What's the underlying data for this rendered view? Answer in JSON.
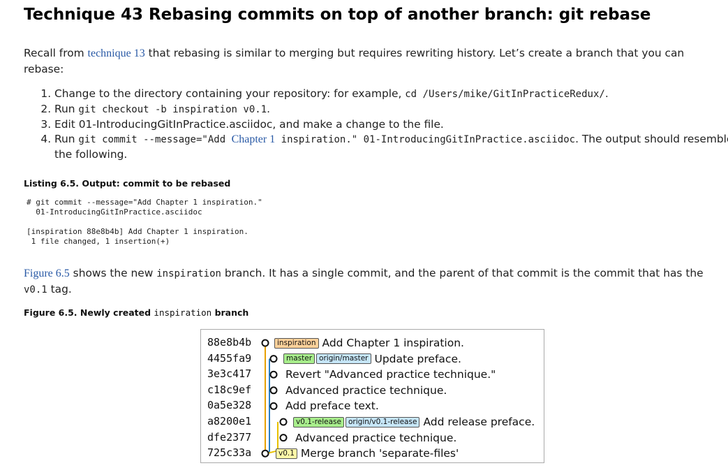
{
  "heading": "Technique 43 Rebasing commits on top of another branch: git rebase",
  "intro": {
    "t1": "Recall from ",
    "link": "technique 13",
    "t2": " that rebasing is similar to merging but requires rewriting history. Let’s create a branch that you can rebase:"
  },
  "steps": {
    "s1_text": "Change to the directory containing your repository: for example, ",
    "s1_code": "cd /Users/mike/GitInPracticeRedux/",
    "s1_end": ".",
    "s2_a": "Run ",
    "s2_code": "git checkout -b inspiration v0.1",
    "s2_end": ".",
    "s3_text": "Edit 01-IntroducingGitInPractice.asciidoc, and make a change to the file.",
    "s4_a": "Run ",
    "s4_code1": "git commit --message=\"Add ",
    "s4_link": "Chapter 1",
    "s4_code2": " inspiration.\" 01-IntroducingGitInPractice.asciidoc",
    "s4_end": ". The output should resemble the following."
  },
  "listing": {
    "caption": "Listing 6.5. Output: commit to be rebased",
    "lines": "# git commit --message=\"Add Chapter 1 inspiration.\"\n  01-IntroducingGitInPractice.asciidoc\n\n[inspiration 88e8b4b] Add Chapter 1 inspiration.\n 1 file changed, 1 insertion(+)"
  },
  "figure_para": {
    "link": "Figure 6.5",
    "t1": " shows the new ",
    "code1": "inspiration",
    "t2": " branch. It has a single commit, and the parent of that commit is the commit that has the ",
    "code2": "v0.1",
    "t3": " tag."
  },
  "figure_caption": {
    "t1": "Figure 6.5. Newly created ",
    "code": "inspiration",
    "t2": " branch"
  },
  "commits": [
    {
      "hash": "88e8b4b",
      "tags": [
        {
          "label": "inspiration",
          "color": "orange"
        }
      ],
      "message": "Add Chapter 1 inspiration."
    },
    {
      "hash": "4455fa9",
      "tags": [
        {
          "label": "master",
          "color": "green"
        },
        {
          "label": "origin/master",
          "color": "blue"
        }
      ],
      "message": "Update preface."
    },
    {
      "hash": "3e3c417",
      "tags": [],
      "message": "Revert \"Advanced practice technique.\""
    },
    {
      "hash": "c18c9ef",
      "tags": [],
      "message": "Advanced practice technique."
    },
    {
      "hash": "0a5e328",
      "tags": [],
      "message": "Add preface text."
    },
    {
      "hash": "a8200e1",
      "tags": [
        {
          "label": "v0.1-release",
          "color": "green"
        },
        {
          "label": "origin/v0.1-release",
          "color": "blue"
        }
      ],
      "message": "Add release preface."
    },
    {
      "hash": "dfe2377",
      "tags": [],
      "message": "Advanced practice technique."
    },
    {
      "hash": "725c33a",
      "tags": [
        {
          "label": "v0.1",
          "color": "yellow"
        }
      ],
      "message": "Merge branch 'separate-files'"
    }
  ],
  "colors": {
    "inspiration_line": "#e8a000",
    "master_line": "#2a7fc0",
    "release_line": "#e8c000",
    "tag_orange": "#ffd19a",
    "tag_green": "#a8ee8c",
    "tag_blue": "#c6e6f8",
    "tag_yellow": "#fff9a8",
    "link": "#2a5aa6"
  }
}
